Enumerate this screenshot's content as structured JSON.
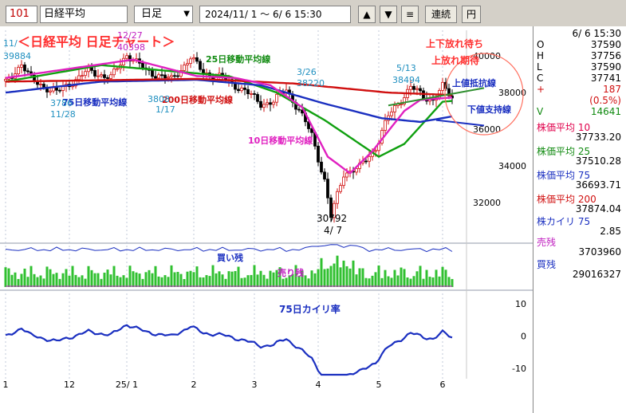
{
  "toolbar": {
    "code": "101",
    "name": "日経平均",
    "period": "日足",
    "range": "2024/11/ 1 ～  6/ 6 15:30",
    "up": "▲",
    "down": "▼",
    "menu": "≡",
    "renzoku": "連続",
    "yen": "円"
  },
  "side": {
    "date": "6/ 6 15:30",
    "ohlc": [
      {
        "k": "O",
        "v": "37590"
      },
      {
        "k": "H",
        "v": "37756"
      },
      {
        "k": "L",
        "v": "37590"
      },
      {
        "k": "C",
        "v": "37741"
      }
    ],
    "chg": "187",
    "chg_pct": "(0.5%)",
    "vol_k": "V",
    "vol": "14641",
    "ma": [
      {
        "label": "株価平均  10",
        "value": "37733.20",
        "color": "#e0004b"
      },
      {
        "label": "株価平均  25",
        "value": "37510.28",
        "color": "#108a10"
      },
      {
        "label": "株価平均  75",
        "value": "36693.71",
        "color": "#1a2fc0"
      },
      {
        "label": "株価平均 200",
        "value": "37874.04",
        "color": "#d01010"
      }
    ],
    "kairi_label": "株カイリ  75",
    "kairi": "2.85",
    "sell_label": "売残",
    "sell": "3703960",
    "buy_label": "買残",
    "buy": "29016327"
  },
  "annotations": {
    "title": "＜日経平均  日足チャート＞",
    "ma25": "25日移動平均線",
    "ma75": "75日移動平均線",
    "ma200": "200日移動平均線",
    "ma10": "10日移動平均線",
    "top1": "上下放れ待ち",
    "top2": "上放れ期待",
    "resist": "上値抵抗線",
    "support": "下値支持線",
    "buy_rem": "買い残",
    "sell_rem": "売り残",
    "kairi_title": "75日カイリ率",
    "p1": {
      "d": "11/",
      "v": "39884"
    },
    "p2": {
      "d": "12/27",
      "v": "40398"
    },
    "p3": {
      "d": "3786",
      "v": "11/28"
    },
    "p4": {
      "d": "3808",
      "v": "1/17"
    },
    "p5": {
      "d": "3/26",
      "v": "38220"
    },
    "p6": {
      "d": "5/13",
      "v": "38494"
    },
    "low_v": "30792",
    "low_d": "4/ 7"
  },
  "chart_data": {
    "type": "candlestick",
    "price_axis": {
      "ticks": [
        "40000",
        "38000",
        "36000",
        "34000",
        "32000"
      ],
      "values": [
        40000,
        38000,
        36000,
        34000,
        32000
      ],
      "ylim": [
        30000,
        41400
      ]
    },
    "kairi_axis": {
      "ticks": [
        "10",
        "0",
        "-10"
      ],
      "values": [
        10,
        0,
        -10
      ],
      "ylim": [
        -12,
        12
      ]
    },
    "x_ticks": [
      "1",
      "12",
      "25/ 1",
      "2",
      "3",
      "4",
      "5",
      "6"
    ],
    "x_tick_index": [
      0,
      20,
      38,
      59,
      78,
      98,
      117,
      137
    ],
    "series": [
      {
        "name": "25日移動平均線",
        "color": "#10a010",
        "knots": [
          [
            0,
            38600
          ],
          [
            30,
            39500
          ],
          [
            50,
            39200
          ],
          [
            70,
            38900
          ],
          [
            85,
            38000
          ],
          [
            100,
            36500
          ],
          [
            117,
            34500
          ],
          [
            125,
            35200
          ],
          [
            137,
            37500
          ],
          [
            140,
            37550
          ]
        ]
      },
      {
        "name": "75日移動平均線",
        "color": "#1a2fc0",
        "knots": [
          [
            0,
            38000
          ],
          [
            30,
            38600
          ],
          [
            60,
            38700
          ],
          [
            80,
            38400
          ],
          [
            100,
            37400
          ],
          [
            118,
            36600
          ],
          [
            130,
            36400
          ],
          [
            140,
            36700
          ]
        ]
      },
      {
        "name": "200日移動平均線",
        "color": "#d01010",
        "knots": [
          [
            0,
            38600
          ],
          [
            60,
            38750
          ],
          [
            90,
            38500
          ],
          [
            120,
            38000
          ],
          [
            140,
            37870
          ]
        ]
      },
      {
        "name": "10日移動平均線",
        "color": "#e020c0",
        "knots": [
          [
            0,
            38800
          ],
          [
            40,
            39800
          ],
          [
            60,
            38900
          ],
          [
            72,
            38800
          ],
          [
            83,
            38400
          ],
          [
            93,
            37200
          ],
          [
            101,
            34500
          ],
          [
            108,
            33600
          ],
          [
            115,
            34800
          ],
          [
            125,
            37000
          ],
          [
            130,
            37600
          ],
          [
            140,
            37730
          ]
        ]
      }
    ],
    "price_path": [
      [
        0,
        38500
      ],
      [
        5,
        39600
      ],
      [
        8,
        38700
      ],
      [
        16,
        38000
      ],
      [
        26,
        39200
      ],
      [
        33,
        38800
      ],
      [
        38,
        40100
      ],
      [
        44,
        39200
      ],
      [
        52,
        38700
      ],
      [
        58,
        39900
      ],
      [
        62,
        39100
      ],
      [
        68,
        38800
      ],
      [
        75,
        38100
      ],
      [
        80,
        37400
      ],
      [
        84,
        37500
      ],
      [
        88,
        38200
      ],
      [
        92,
        37000
      ],
      [
        96,
        35700
      ],
      [
        100,
        33200
      ],
      [
        102,
        31200
      ],
      [
        103,
        31800
      ],
      [
        106,
        33600
      ],
      [
        111,
        33900
      ],
      [
        116,
        35000
      ],
      [
        120,
        36700
      ],
      [
        123,
        37400
      ],
      [
        127,
        38300
      ],
      [
        131,
        37800
      ],
      [
        134,
        37600
      ],
      [
        137,
        38300
      ],
      [
        140,
        37740
      ]
    ]
  }
}
